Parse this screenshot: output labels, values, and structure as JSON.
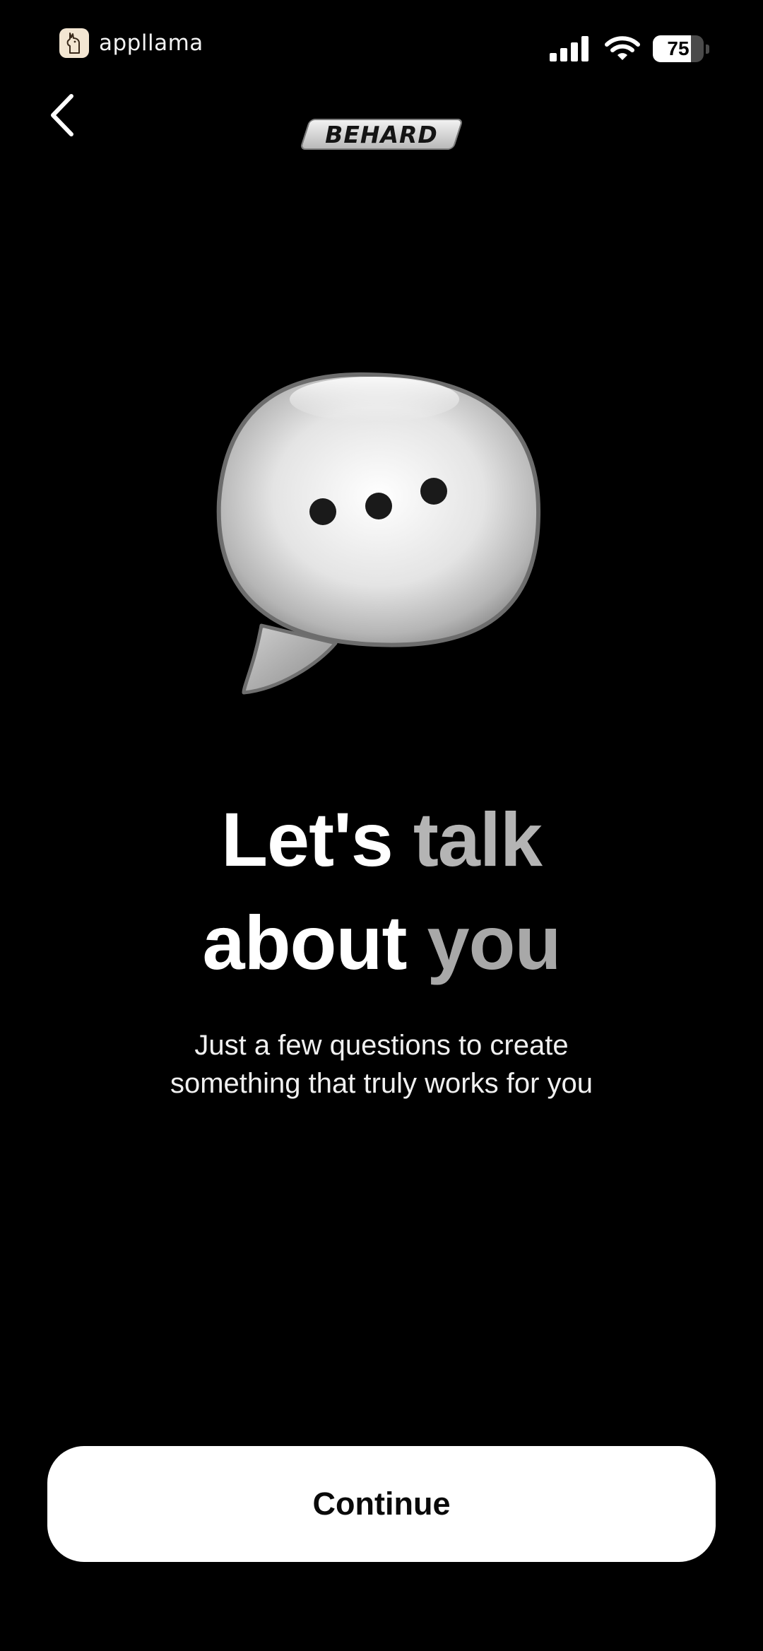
{
  "status_bar": {
    "carrier_label": "appllama",
    "carrier_icon": "llama-icon",
    "signal_icon": "cellular-signal-icon",
    "wifi_icon": "wifi-icon",
    "battery_level": "75",
    "battery_fraction": 0.75
  },
  "nav": {
    "back_icon": "chevron-left-icon",
    "brand_logo_text": "BEHARD"
  },
  "hero": {
    "icon": "speech-bubble-icon",
    "headline_line1": [
      "Let's",
      "talk"
    ],
    "headline_line2": [
      "about",
      "you"
    ],
    "subtitle_line1": "Just a few questions to create",
    "subtitle_line2": "something that truly works for you"
  },
  "footer": {
    "continue_label": "Continue"
  },
  "colors": {
    "background": "#000000",
    "button_background": "#ffffff",
    "button_text": "#0a0a0a",
    "headline_bright": "#ffffff",
    "headline_dim": "#a8a8a8"
  }
}
